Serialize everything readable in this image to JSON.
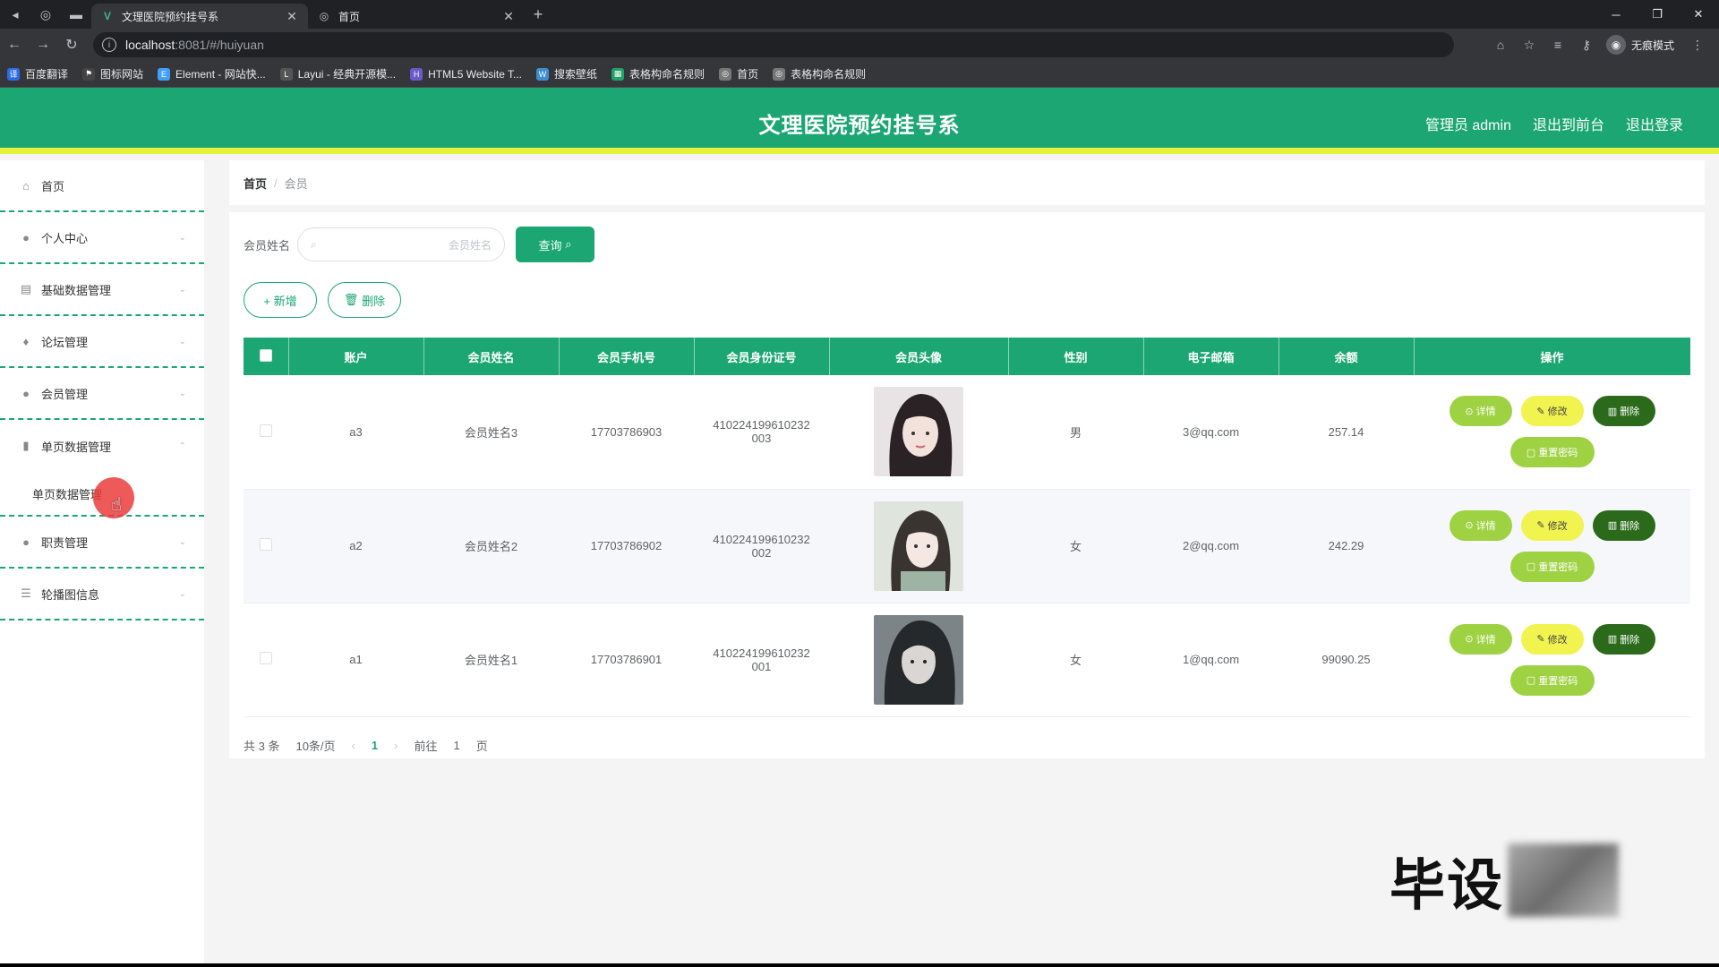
{
  "browser": {
    "tabs": [
      {
        "title": "文理医院预约挂号系",
        "active": true
      },
      {
        "title": "首页",
        "active": false
      }
    ],
    "url_host": "localhost",
    "url_path": ":8081/#/huiyuan",
    "incognito_label": "无痕模式",
    "bookmarks": [
      "百度翻译",
      "图标网站",
      "Element - 网站快...",
      "Layui - 经典开源模...",
      "HTML5 Website T...",
      "搜索壁纸",
      "表格构命名规则",
      "首页",
      "表格构命名规则"
    ]
  },
  "header": {
    "title": "文理医院预约挂号系",
    "admin": "管理员 admin",
    "to_front": "退出到前台",
    "logout": "退出登录"
  },
  "sidebar": {
    "items": [
      {
        "label": "首页",
        "icon": "home-icon"
      },
      {
        "label": "个人中心",
        "icon": "user-icon"
      },
      {
        "label": "基础数据管理",
        "icon": "database-icon"
      },
      {
        "label": "论坛管理",
        "icon": "pin-icon"
      },
      {
        "label": "会员管理",
        "icon": "user-icon"
      },
      {
        "label": "单页数据管理",
        "icon": "bar-chart-icon"
      }
    ],
    "sub_item": "单页数据管理",
    "items_after": [
      {
        "label": "职责管理",
        "icon": "user-icon"
      },
      {
        "label": "轮播图信息",
        "icon": "list-icon"
      }
    ]
  },
  "breadcrumb": {
    "home": "首页",
    "current": "会员"
  },
  "search": {
    "label": "会员姓名",
    "placeholder": "会员姓名",
    "button": "查询"
  },
  "actions": {
    "add": "+ 新增",
    "delete": "删除"
  },
  "table": {
    "columns": [
      "账户",
      "会员姓名",
      "会员手机号",
      "会员身份证号",
      "会员头像",
      "性别",
      "电子邮箱",
      "余额",
      "操作"
    ],
    "rows": [
      {
        "account": "a3",
        "name": "会员姓名3",
        "phone": "17703786903",
        "id_line1": "410224199610232",
        "id_line2": "003",
        "gender": "男",
        "email": "3@qq.com",
        "balance": "257.14",
        "avatar_color": "#5b4a52"
      },
      {
        "account": "a2",
        "name": "会员姓名2",
        "phone": "17703786902",
        "id_line1": "410224199610232",
        "id_line2": "002",
        "gender": "女",
        "email": "2@qq.com",
        "balance": "242.29",
        "avatar_color": "#c9cfc6"
      },
      {
        "account": "a1",
        "name": "会员姓名1",
        "phone": "17703786901",
        "id_line1": "410224199610232",
        "id_line2": "001",
        "gender": "女",
        "email": "1@qq.com",
        "balance": "99090.25",
        "avatar_color": "#3f4549"
      }
    ],
    "ops": {
      "detail": "详情",
      "edit": "修改",
      "del": "删除",
      "reset": "重置密码"
    }
  },
  "pager": {
    "total": "共 3 条",
    "size": "10条/页",
    "page": "1",
    "goto": "前往",
    "goto_page": "1",
    "unit": "页"
  },
  "watermark": "毕设"
}
